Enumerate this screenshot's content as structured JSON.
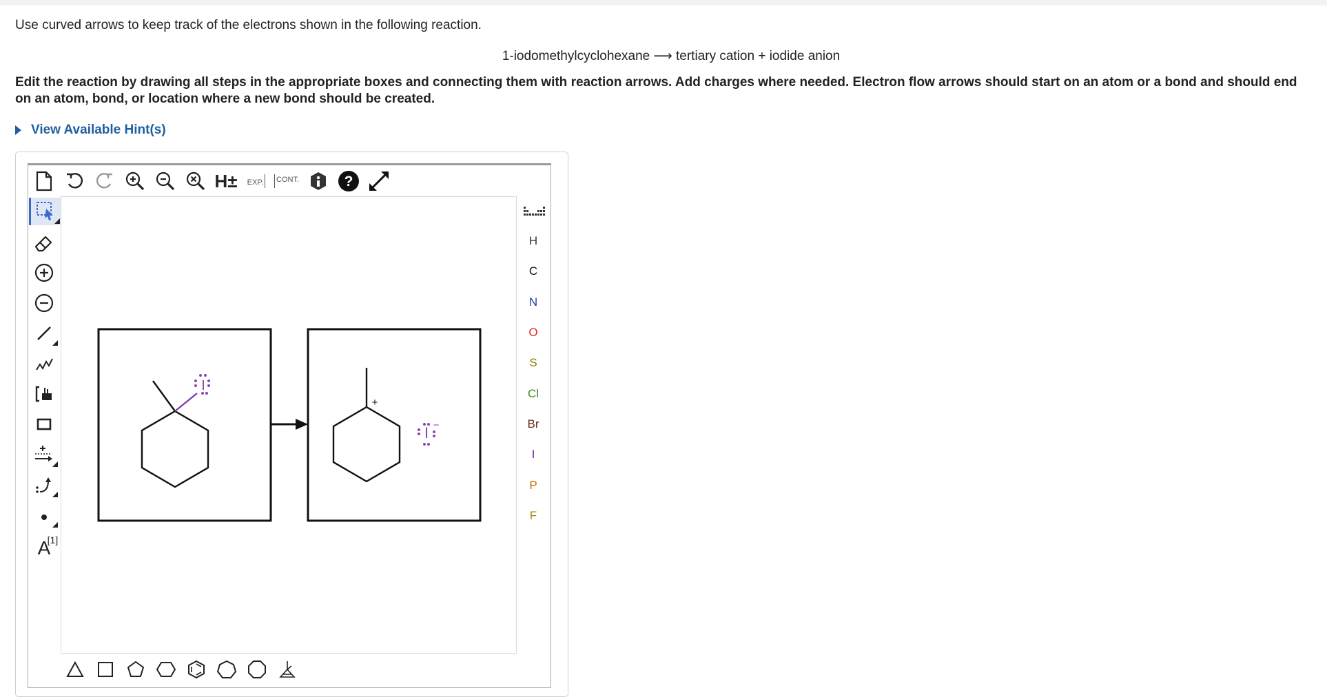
{
  "question": {
    "intro": "Use curved arrows to keep track of the electrons shown in the following reaction.",
    "reaction": "1-iodomethylcyclohexane ⟶ tertiary cation + iodide anion",
    "instructions": "Edit the reaction by drawing all steps in the appropriate boxes and connecting them with reaction arrows. Add charges where needed. Electron flow arrows should start on an atom or a bond and should end on an atom, bond, or location where a new bond should be created.",
    "hint_label": "View Available Hint(s)"
  },
  "toolbar_top": {
    "h_label": "H±",
    "exp_label": "EXP.",
    "cont_label": "CONT."
  },
  "toolbar_left": {
    "text_tool_label": "A",
    "text_tool_sup": "[1]"
  },
  "atoms": [
    {
      "symbol": "H",
      "color": "#333333"
    },
    {
      "symbol": "C",
      "color": "#111111"
    },
    {
      "symbol": "N",
      "color": "#1a3fa0"
    },
    {
      "symbol": "O",
      "color": "#e0251b"
    },
    {
      "symbol": "S",
      "color": "#8a7a00"
    },
    {
      "symbol": "Cl",
      "color": "#3a8f1f"
    },
    {
      "symbol": "Br",
      "color": "#6b2a1a"
    },
    {
      "symbol": "I",
      "color": "#6a1b9a"
    },
    {
      "symbol": "P",
      "color": "#c96a00"
    },
    {
      "symbol": "F",
      "color": "#a8890d"
    }
  ],
  "drawing": {
    "reactant_atom": "I",
    "product_charge": "+",
    "anion_atom": "I",
    "anion_charge": "−",
    "iodine_color": "#8e44ad"
  }
}
